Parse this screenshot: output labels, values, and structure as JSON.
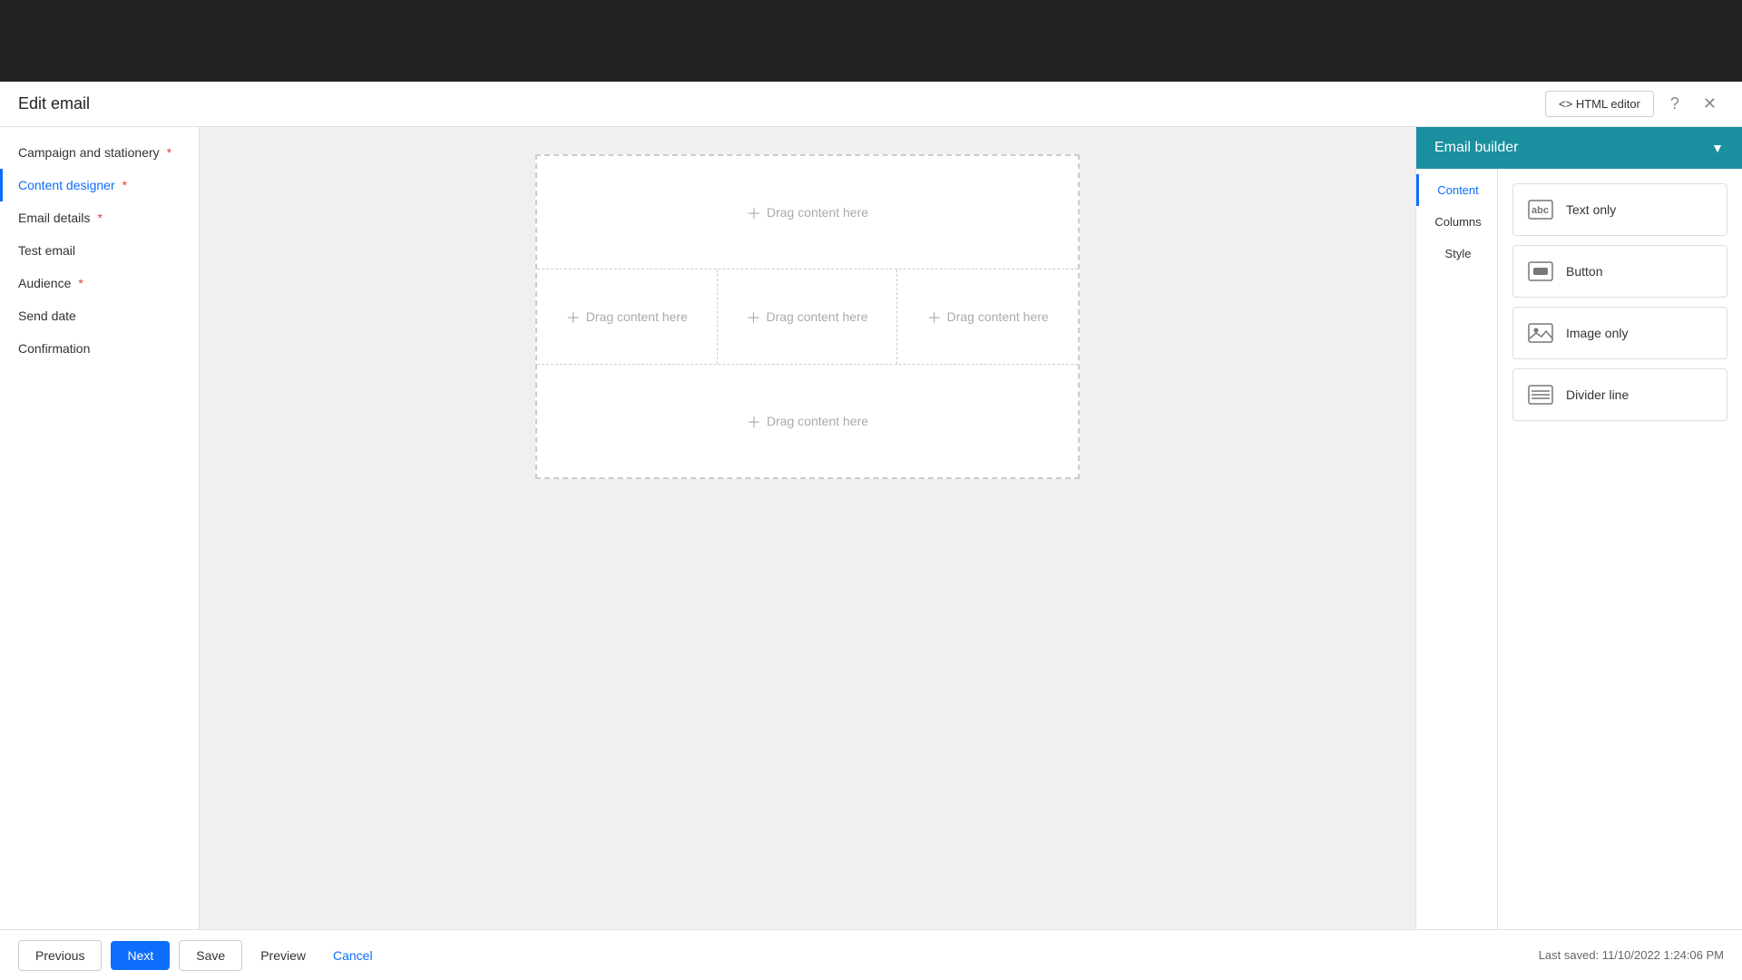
{
  "topbar": {},
  "header": {
    "title": "Edit email",
    "html_editor_label": "<> HTML editor"
  },
  "sidebar": {
    "items": [
      {
        "id": "campaign",
        "label": "Campaign and stationery",
        "required": true,
        "active": false
      },
      {
        "id": "content-designer",
        "label": "Content designer",
        "required": true,
        "active": true
      },
      {
        "id": "email-details",
        "label": "Email details",
        "required": true,
        "active": false
      },
      {
        "id": "test-email",
        "label": "Test email",
        "required": false,
        "active": false
      },
      {
        "id": "audience",
        "label": "Audience",
        "required": true,
        "active": false
      },
      {
        "id": "send-date",
        "label": "Send date",
        "required": false,
        "active": false
      },
      {
        "id": "confirmation",
        "label": "Confirmation",
        "required": false,
        "active": false
      }
    ]
  },
  "canvas": {
    "rows": [
      {
        "type": "single",
        "zones": [
          "Drag content here"
        ]
      },
      {
        "type": "triple",
        "zones": [
          "Drag content here",
          "Drag content here",
          "Drag content here"
        ]
      },
      {
        "type": "single",
        "zones": [
          "Drag content here"
        ]
      }
    ]
  },
  "right_panel": {
    "header": "Email builder",
    "tabs": [
      {
        "id": "content",
        "label": "Content",
        "active": true
      },
      {
        "id": "columns",
        "label": "Columns",
        "active": false
      },
      {
        "id": "style",
        "label": "Style",
        "active": false
      }
    ],
    "content_blocks": [
      {
        "id": "text-only",
        "label": "Text only",
        "icon_type": "text"
      },
      {
        "id": "button",
        "label": "Button",
        "icon_type": "button"
      },
      {
        "id": "image-only",
        "label": "Image only",
        "icon_type": "image"
      },
      {
        "id": "divider-line",
        "label": "Divider line",
        "icon_type": "divider"
      }
    ]
  },
  "bottom_bar": {
    "previous_label": "Previous",
    "next_label": "Next",
    "save_label": "Save",
    "preview_label": "Preview",
    "cancel_label": "Cancel",
    "last_saved": "Last saved: 11/10/2022 1:24:06 PM"
  }
}
